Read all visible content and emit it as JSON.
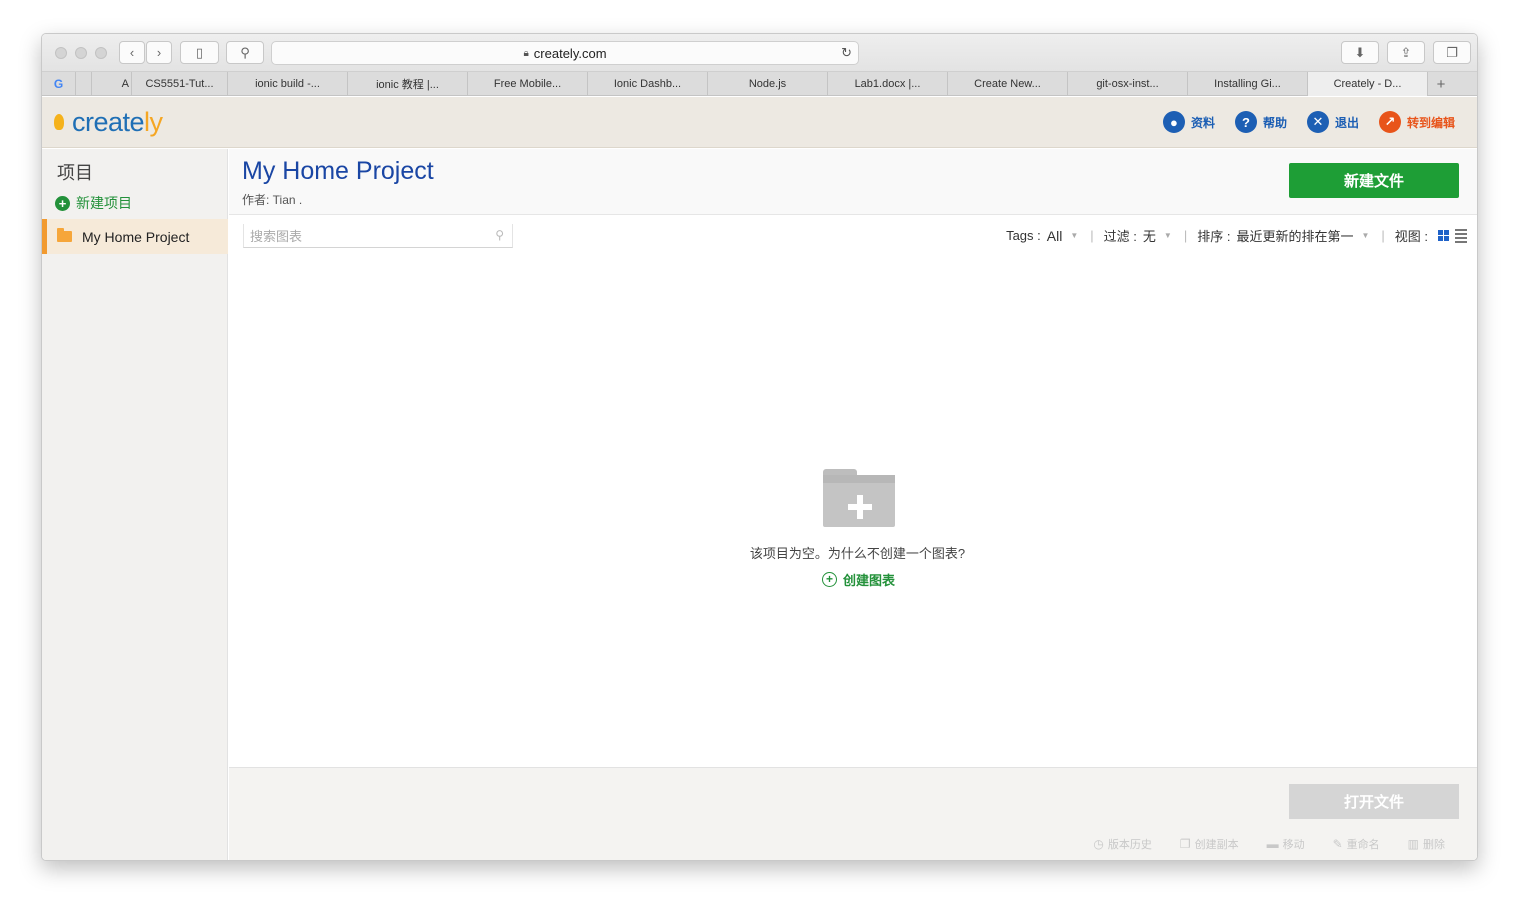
{
  "browser": {
    "url": "creately.com",
    "tabs": [
      {
        "label": "G"
      },
      {
        "label": ""
      },
      {
        "label": ""
      },
      {
        "label": "A"
      },
      {
        "label": "CS5551-Tut..."
      },
      {
        "label": "ionic build -..."
      },
      {
        "label": "ionic 教程 |..."
      },
      {
        "label": "Free Mobile..."
      },
      {
        "label": "Ionic Dashb..."
      },
      {
        "label": "Node.js"
      },
      {
        "label": "Lab1.docx |..."
      },
      {
        "label": "Create New..."
      },
      {
        "label": "git-osx-inst..."
      },
      {
        "label": "Installing Gi..."
      },
      {
        "label": "Creately - D..."
      },
      {
        "label": "+"
      }
    ]
  },
  "header": {
    "logo_main": "create",
    "logo_accent": "ly",
    "links": {
      "profile": "资料",
      "help": "帮助",
      "logout": "退出",
      "edit": "转到编辑"
    },
    "icons": {
      "profile": "user-icon",
      "help": "question-icon",
      "logout": "close-icon",
      "edit": "external-edit-icon"
    }
  },
  "sidebar": {
    "title": "项目",
    "new_project": "新建项目",
    "items": [
      {
        "label": "My Home Project"
      }
    ]
  },
  "main": {
    "project_title": "My Home Project",
    "author": "作者: Tian .",
    "new_file": "新建文件",
    "search_placeholder": "搜索图表",
    "filters": {
      "tags_label": "Tags :",
      "tags_value": "All",
      "filter_label": "过滤 :",
      "filter_value": "无",
      "sort_label": "排序 :",
      "sort_value": "最近更新的排在第一",
      "view_label": "视图 :"
    },
    "empty_message": "该项目为空。为什么不创建一个图表?",
    "create_chart": "创建图表"
  },
  "bottom": {
    "open_file": "打开文件",
    "actions": {
      "history": "版本历史",
      "copy": "创建副本",
      "move": "移动",
      "rename": "重命名",
      "delete": "删除"
    }
  },
  "colors": {
    "brand_blue": "#1f6fb5",
    "accent_orange": "#f5a623",
    "green": "#1e9e36",
    "title_blue": "#1a46a4"
  }
}
